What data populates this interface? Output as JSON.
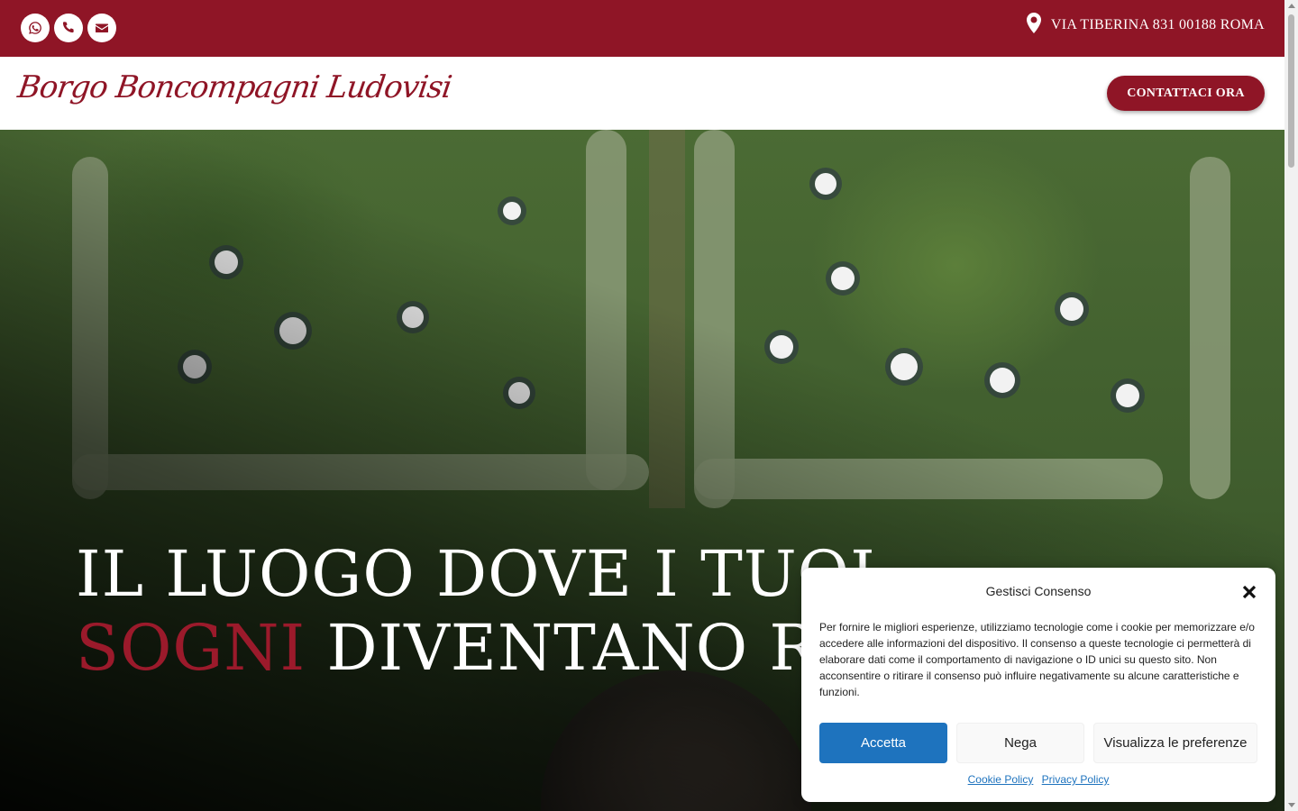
{
  "topbar": {
    "social": [
      {
        "icon": "whatsapp-icon"
      },
      {
        "icon": "phone-icon"
      },
      {
        "icon": "envelope-icon"
      }
    ],
    "address": "VIA TIBERINA 831 00188 ROMA",
    "address_icon": "map-pin-icon",
    "background": "#8f1526"
  },
  "header": {
    "logo": "Borgo Boncompagni Ludovisi",
    "cta": "CONTATTACI ORA"
  },
  "hero": {
    "line1": "IL LUOGO DOVE I TUOI",
    "accent": "SOGNI",
    "line2_rest": "DIVENTANO R"
  },
  "consent": {
    "title": "Gestisci Consenso",
    "text": "Per fornire le migliori esperienze, utilizziamo tecnologie come i cookie per memorizzare e/o accedere alle informazioni del dispositivo. Il consenso a queste tecnologie ci permetterà di elaborare dati come il comportamento di navigazione o ID unici su questo sito. Non acconsentire o ritirare il consenso può influire negativamente su alcune caratteristiche e funzioni.",
    "accept": "Accetta",
    "deny": "Nega",
    "preferences": "Visualizza le preferenze",
    "cookie_policy": "Cookie Policy",
    "privacy_policy": "Privacy Policy",
    "accent_color": "#1e73be"
  }
}
